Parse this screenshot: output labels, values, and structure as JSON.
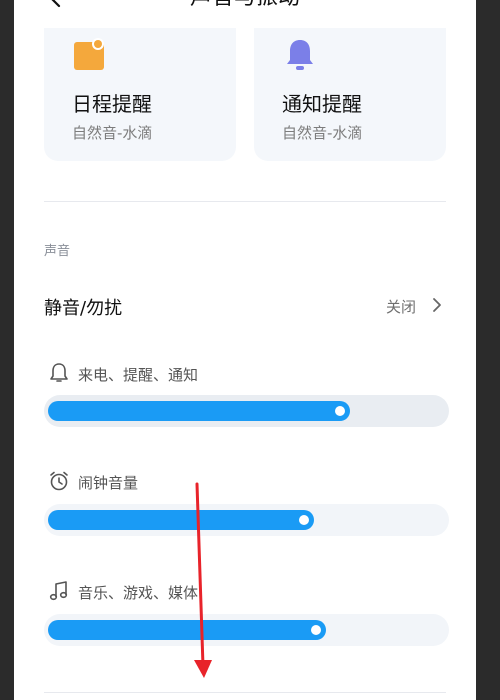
{
  "header": {
    "title": "声音与振动"
  },
  "cards": [
    {
      "title": "日程提醒",
      "subtitle": "自然音-水滴",
      "icon": "calendar-icon",
      "color": "#F4A83C"
    },
    {
      "title": "通知提醒",
      "subtitle": "自然音-水滴",
      "icon": "bell-icon",
      "color": "#7B7FE8"
    }
  ],
  "section": {
    "label": "声音"
  },
  "silent_row": {
    "title": "静音/勿扰",
    "value": "关闭"
  },
  "volumes": [
    {
      "label": "来电、提醒、通知",
      "icon": "bell-outline-icon",
      "level": 0.76
    },
    {
      "label": "闹钟音量",
      "icon": "alarm-clock-icon",
      "level": 0.67
    },
    {
      "label": "音乐、游戏、媒体",
      "icon": "music-note-icon",
      "level": 0.7
    }
  ],
  "accent": "#1A9BF5",
  "annotation_color": "#E8232A"
}
